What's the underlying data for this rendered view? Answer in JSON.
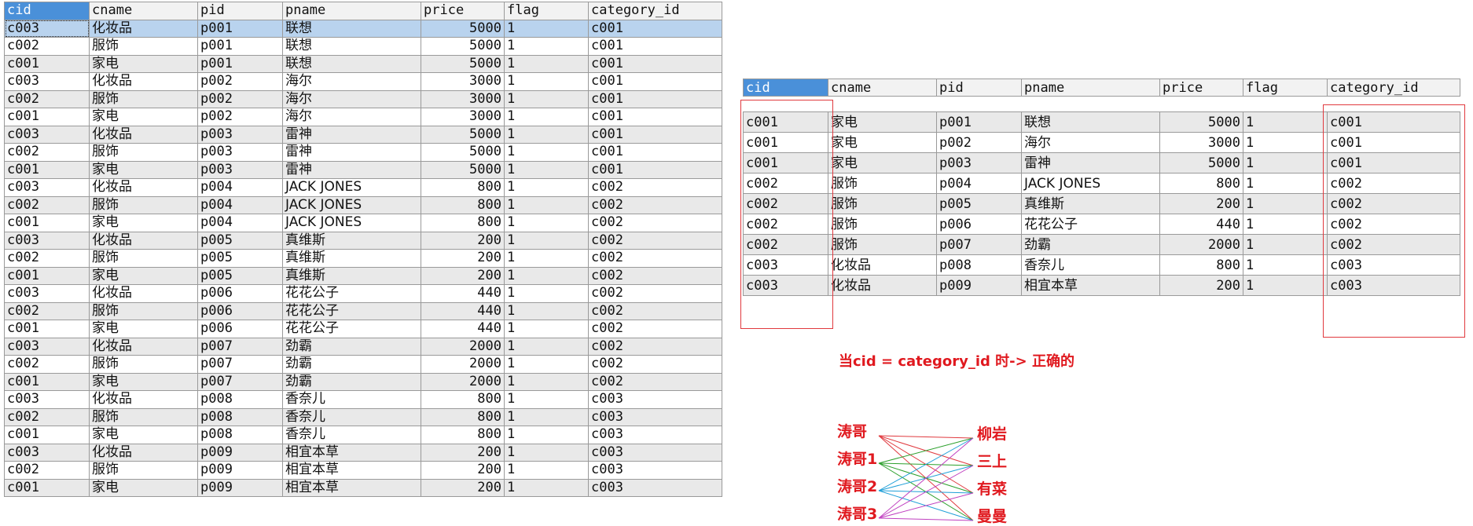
{
  "left_table": {
    "columns": [
      "cid",
      "cname",
      "pid",
      "pname",
      "price",
      "flag",
      "category_id"
    ],
    "rows": [
      [
        "c003",
        "化妆品",
        "p001",
        "联想",
        "5000",
        "1",
        "c001"
      ],
      [
        "c002",
        "服饰",
        "p001",
        "联想",
        "5000",
        "1",
        "c001"
      ],
      [
        "c001",
        "家电",
        "p001",
        "联想",
        "5000",
        "1",
        "c001"
      ],
      [
        "c003",
        "化妆品",
        "p002",
        "海尔",
        "3000",
        "1",
        "c001"
      ],
      [
        "c002",
        "服饰",
        "p002",
        "海尔",
        "3000",
        "1",
        "c001"
      ],
      [
        "c001",
        "家电",
        "p002",
        "海尔",
        "3000",
        "1",
        "c001"
      ],
      [
        "c003",
        "化妆品",
        "p003",
        "雷神",
        "5000",
        "1",
        "c001"
      ],
      [
        "c002",
        "服饰",
        "p003",
        "雷神",
        "5000",
        "1",
        "c001"
      ],
      [
        "c001",
        "家电",
        "p003",
        "雷神",
        "5000",
        "1",
        "c001"
      ],
      [
        "c003",
        "化妆品",
        "p004",
        "JACK JONES",
        "800",
        "1",
        "c002"
      ],
      [
        "c002",
        "服饰",
        "p004",
        "JACK JONES",
        "800",
        "1",
        "c002"
      ],
      [
        "c001",
        "家电",
        "p004",
        "JACK JONES",
        "800",
        "1",
        "c002"
      ],
      [
        "c003",
        "化妆品",
        "p005",
        "真维斯",
        "200",
        "1",
        "c002"
      ],
      [
        "c002",
        "服饰",
        "p005",
        "真维斯",
        "200",
        "1",
        "c002"
      ],
      [
        "c001",
        "家电",
        "p005",
        "真维斯",
        "200",
        "1",
        "c002"
      ],
      [
        "c003",
        "化妆品",
        "p006",
        "花花公子",
        "440",
        "1",
        "c002"
      ],
      [
        "c002",
        "服饰",
        "p006",
        "花花公子",
        "440",
        "1",
        "c002"
      ],
      [
        "c001",
        "家电",
        "p006",
        "花花公子",
        "440",
        "1",
        "c002"
      ],
      [
        "c003",
        "化妆品",
        "p007",
        "劲霸",
        "2000",
        "1",
        "c002"
      ],
      [
        "c002",
        "服饰",
        "p007",
        "劲霸",
        "2000",
        "1",
        "c002"
      ],
      [
        "c001",
        "家电",
        "p007",
        "劲霸",
        "2000",
        "1",
        "c002"
      ],
      [
        "c003",
        "化妆品",
        "p008",
        "香奈儿",
        "800",
        "1",
        "c003"
      ],
      [
        "c002",
        "服饰",
        "p008",
        "香奈儿",
        "800",
        "1",
        "c003"
      ],
      [
        "c001",
        "家电",
        "p008",
        "香奈儿",
        "800",
        "1",
        "c003"
      ],
      [
        "c003",
        "化妆品",
        "p009",
        "相宜本草",
        "200",
        "1",
        "c003"
      ],
      [
        "c002",
        "服饰",
        "p009",
        "相宜本草",
        "200",
        "1",
        "c003"
      ],
      [
        "c001",
        "家电",
        "p009",
        "相宜本草",
        "200",
        "1",
        "c003"
      ]
    ]
  },
  "right_table": {
    "columns": [
      "cid",
      "cname",
      "pid",
      "pname",
      "price",
      "flag",
      "category_id"
    ],
    "rows": [
      [
        "c001",
        "家电",
        "p001",
        "联想",
        "5000",
        "1",
        "c001"
      ],
      [
        "c001",
        "家电",
        "p002",
        "海尔",
        "3000",
        "1",
        "c001"
      ],
      [
        "c001",
        "家电",
        "p003",
        "雷神",
        "5000",
        "1",
        "c001"
      ],
      [
        "c002",
        "服饰",
        "p004",
        "JACK JONES",
        "800",
        "1",
        "c002"
      ],
      [
        "c002",
        "服饰",
        "p005",
        "真维斯",
        "200",
        "1",
        "c002"
      ],
      [
        "c002",
        "服饰",
        "p006",
        "花花公子",
        "440",
        "1",
        "c002"
      ],
      [
        "c002",
        "服饰",
        "p007",
        "劲霸",
        "2000",
        "1",
        "c002"
      ],
      [
        "c003",
        "化妆品",
        "p008",
        "香奈儿",
        "800",
        "1",
        "c003"
      ],
      [
        "c003",
        "化妆品",
        "p009",
        "相宜本草",
        "200",
        "1",
        "c003"
      ]
    ]
  },
  "note": "当cid = category_id 时-> 正确的",
  "diagram": {
    "left": [
      "涛哥",
      "涛哥1",
      "涛哥2",
      "涛哥3"
    ],
    "right": [
      "柳岩",
      "三上",
      "有菜",
      "曼曼"
    ],
    "line_colors": [
      "#e0393e",
      "#2ca02c",
      "#1f9fd8",
      "#c040c0"
    ]
  },
  "colors": {
    "selected_header": "#4a90d9",
    "selected_row": "#b9d3ee",
    "highlight_red": "#e0191f"
  }
}
